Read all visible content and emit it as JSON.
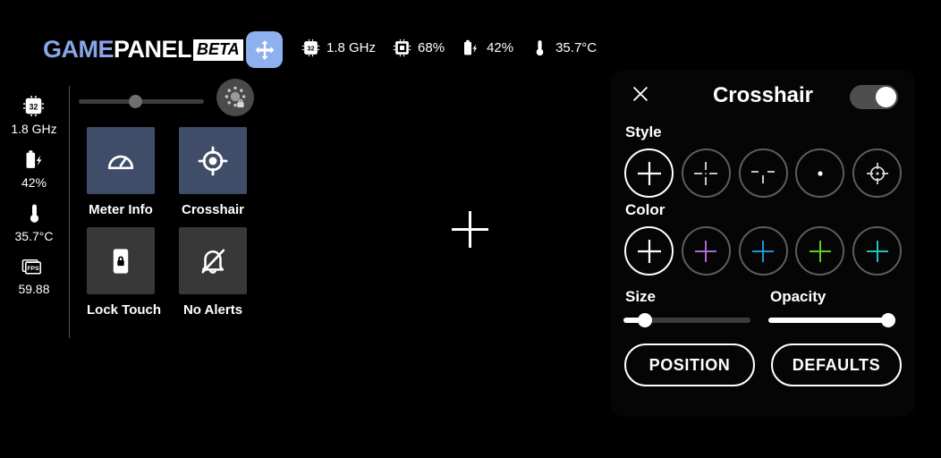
{
  "app": {
    "logo_game": "GAME",
    "logo_panel": "PANEL",
    "logo_beta": "BETA",
    "accent_blue": "#8fb0ee"
  },
  "topbar": {
    "move_icon": "move-arrows-icon",
    "stats": [
      {
        "icon": "cpu-chip-icon",
        "value": "1.8 GHz"
      },
      {
        "icon": "memory-chip-icon",
        "value": "68%"
      },
      {
        "icon": "battery-charging-icon",
        "value": "42%"
      },
      {
        "icon": "thermometer-icon",
        "value": "35.7°C"
      }
    ]
  },
  "sidebar": {
    "items": [
      {
        "icon": "cpu-chip-icon",
        "value": "1.8 GHz"
      },
      {
        "icon": "battery-charging-icon",
        "value": "42%"
      },
      {
        "icon": "thermometer-icon",
        "value": "35.7°C"
      },
      {
        "icon": "fps-icon",
        "value": "59.88"
      }
    ]
  },
  "brightness": {
    "slider_value": 40,
    "lock_button_icon": "brightness-lock-icon"
  },
  "tiles": [
    {
      "label": "Meter Info",
      "icon": "speedometer-icon",
      "active": true
    },
    {
      "label": "Crosshair",
      "icon": "target-icon",
      "active": true
    },
    {
      "label": "Lock Touch",
      "icon": "phone-lock-icon",
      "active": false
    },
    {
      "label": "No Alerts",
      "icon": "bell-off-icon",
      "active": false
    }
  ],
  "preview": {
    "crosshair_icon": "plus-crosshair-preview"
  },
  "crosshair_panel": {
    "close_icon": "close-icon",
    "title": "Crosshair",
    "enabled": true,
    "style_label": "Style",
    "styles": [
      {
        "name": "plus-cross",
        "selected": true
      },
      {
        "name": "dashed-cross",
        "selected": false
      },
      {
        "name": "gap-cross",
        "selected": false
      },
      {
        "name": "dot",
        "selected": false
      },
      {
        "name": "scope-circle-cross",
        "selected": false
      }
    ],
    "color_label": "Color",
    "colors": [
      {
        "name": "white",
        "hex": "#ffffff",
        "selected": true
      },
      {
        "name": "purple",
        "hex": "#a86bd4",
        "selected": false
      },
      {
        "name": "blue",
        "hex": "#2292d8",
        "selected": false
      },
      {
        "name": "green",
        "hex": "#62cc22",
        "selected": false
      },
      {
        "name": "teal",
        "hex": "#1fc2b8",
        "selected": false
      }
    ],
    "size_label": "Size",
    "size_value": 17,
    "opacity_label": "Opacity",
    "opacity_value": 100,
    "position_button": "POSITION",
    "defaults_button": "DEFAULTS"
  }
}
